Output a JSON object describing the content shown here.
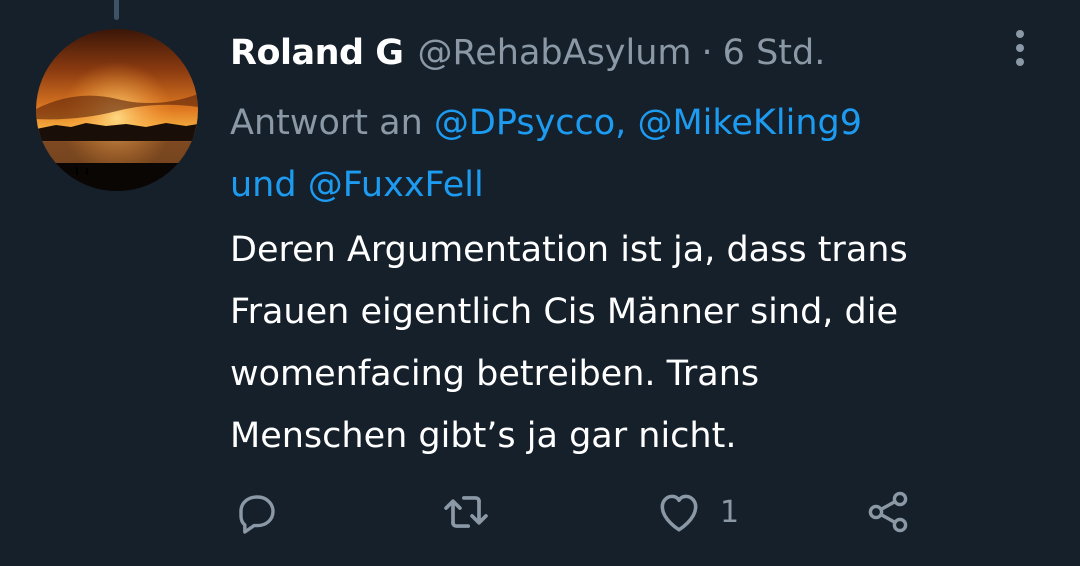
{
  "tweet": {
    "display_name": "Roland G",
    "handle": "@RehabAsylum",
    "separator": "·",
    "time": "6 Std.",
    "reply_prefix": "Antwort an ",
    "mention_1": "@DPsycco,",
    "mention_2": "@MikeKling9",
    "reply_and": "und ",
    "mention_3": "@FuxxFell",
    "text": "Deren Argumentation ist ja, dass trans\nFrauen eigentlich Cis Männer sind, die\nwomenfacing betreiben. Trans\nMenschen gibt’s ja gar nicht.",
    "like_count": "1"
  },
  "icons": {
    "more": "more-vertical-icon",
    "reply": "reply-icon",
    "retweet": "retweet-icon",
    "like": "like-heart-icon",
    "share": "share-icon"
  },
  "colors": {
    "background": "#15202b",
    "text": "#ffffff",
    "secondary": "#8b98a5",
    "mention": "#1d9bf0"
  }
}
